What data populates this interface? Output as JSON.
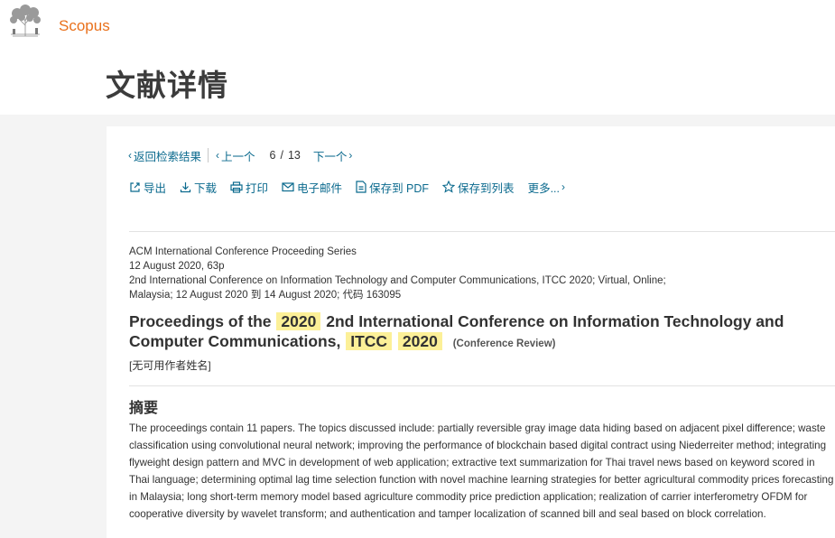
{
  "header": {
    "brand": "Scopus",
    "page_title": "文献详情"
  },
  "nav": {
    "back_label": "返回检索结果",
    "prev_label": "上一个",
    "current": "6",
    "separator": "/",
    "total": "13",
    "next_label": "下一个"
  },
  "actions": {
    "export": "导出",
    "download": "下载",
    "print": "打印",
    "email": "电子邮件",
    "save_pdf": "保存到 PDF",
    "save_list": "保存到列表",
    "more": "更多..."
  },
  "meta": {
    "series": "ACM International Conference Proceeding Series",
    "date_pages": "12 August 2020, 63p",
    "conference": "2nd International Conference on Information Technology and Computer Communications, ITCC 2020; Virtual, Online;",
    "location_code": "Malaysia; 12 August 2020 到 14 August 2020; 代码 163095"
  },
  "document": {
    "title_part1": "Proceedings of the",
    "title_hl1": "2020",
    "title_part2": "2nd International Conference on Information Technology and Computer Communications,",
    "title_hl2": "ITCC",
    "title_hl3": "2020",
    "doc_type": "(Conference Review)",
    "no_author": "[无可用作者姓名]"
  },
  "abstract": {
    "heading": "摘要",
    "text": "The proceedings contain 11 papers. The topics discussed include: partially reversible gray image data hiding based on adjacent pixel difference; waste classification using convolutional neural network; improving the performance of blockchain based digital contract using Niederreiter method; integrating flyweight design pattern and MVC in development of web application; extractive text summarization for Thai travel news based on keyword scored in Thai language; determining optimal lag time selection function with novel machine learning strategies for better agricultural commodity prices forecasting in Malaysia; long short-term memory model based agriculture commodity price prediction application; realization of carrier interferometry OFDM for cooperative diversity by wavelet transform; and authentication and tamper localization of scanned bill and seal based on block correlation."
  },
  "colors": {
    "brand": "#e9711c",
    "link": "#0b6a8e",
    "highlight": "#fcf098"
  }
}
